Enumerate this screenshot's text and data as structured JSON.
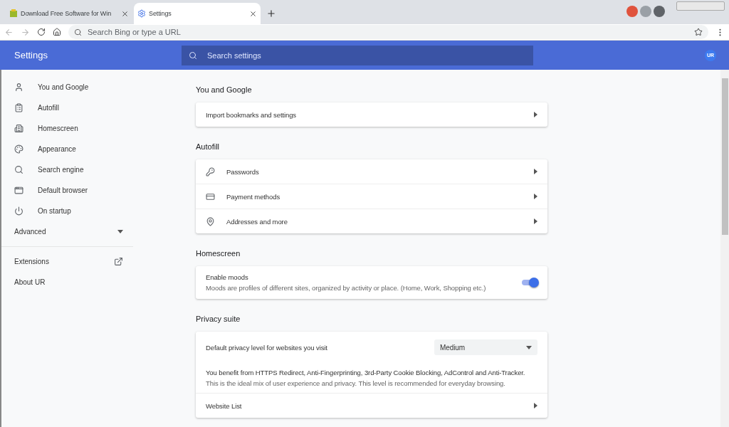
{
  "tabs": [
    {
      "title": "Download Free Software for Win",
      "selected": false
    },
    {
      "title": "Settings",
      "selected": true
    }
  ],
  "address_bar": {
    "placeholder": "Search Bing or type a URL"
  },
  "header": {
    "title": "Settings",
    "search": {
      "placeholder": "Search settings"
    },
    "profile": "UR"
  },
  "sidebar": {
    "items": [
      {
        "label": "You and Google"
      },
      {
        "label": "Autofill"
      },
      {
        "label": "Homescreen"
      },
      {
        "label": "Appearance"
      },
      {
        "label": "Search engine"
      },
      {
        "label": "Default browser"
      },
      {
        "label": "On startup"
      }
    ],
    "advanced": {
      "label": "Advanced",
      "expanded": false
    },
    "links": [
      {
        "label": "Extensions",
        "kind": "external"
      },
      {
        "label": "About UR",
        "kind": "plain"
      }
    ]
  },
  "sections": [
    {
      "title": "You and Google",
      "rows": [
        {
          "kind": "link",
          "label": "Import bookmarks and settings"
        }
      ]
    },
    {
      "title": "Autofill",
      "rows": [
        {
          "kind": "icon_link",
          "label": "Passwords"
        },
        {
          "kind": "icon_link",
          "label": "Payment methods"
        },
        {
          "kind": "icon_link",
          "label": "Addresses and more"
        }
      ]
    },
    {
      "title": "Homescreen",
      "rows": [
        {
          "kind": "toggle",
          "label": "Enable moods",
          "description": "Moods are profiles of different sites, organized by activity or place. (Home, Work, Shopping etc.)",
          "on": true
        }
      ]
    },
    {
      "title": "Privacy suite",
      "rows": [
        {
          "kind": "select",
          "label": "Default privacy level for websites you visit",
          "value": "Medium"
        },
        {
          "kind": "text",
          "lines": [
            "You benefit from HTTPS Redirect, Anti-Fingerprinting, 3rd-Party Cookie Blocking, AdControl and Anti-Tracker.",
            "This is the ideal mix of user experience and privacy. This level is recommended for everyday browsing."
          ]
        },
        {
          "kind": "link",
          "label": "Website List"
        }
      ]
    }
  ]
}
